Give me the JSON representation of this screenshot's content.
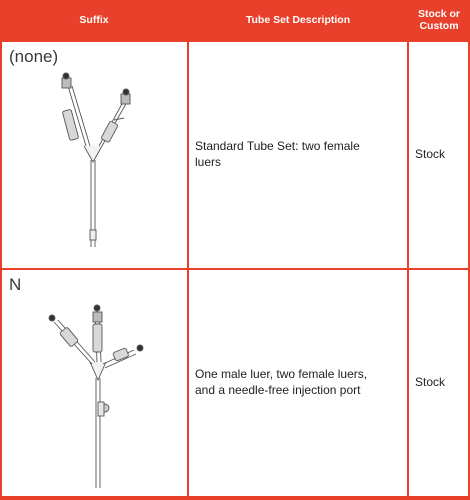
{
  "colors": {
    "header_bg": "#e8402b",
    "header_text": "#ffffff",
    "cell_bg": "#ffffff"
  },
  "header": {
    "suffix": "Suffix",
    "description": "Tube Set Description",
    "stock_custom_line1": "Stock or",
    "stock_custom_line2": "Custom"
  },
  "rows": [
    {
      "suffix": "(none)",
      "illustration": "tube-set-two-female-luers-icon",
      "description_line1": "Standard Tube Set: two female",
      "description_line2": "luers",
      "stock": "Stock"
    },
    {
      "suffix": "N",
      "illustration": "tube-set-male-female-needle-free-icon",
      "description_line1": "One male luer, two female luers,",
      "description_line2": "and a needle-free injection port",
      "stock": "Stock"
    }
  ]
}
